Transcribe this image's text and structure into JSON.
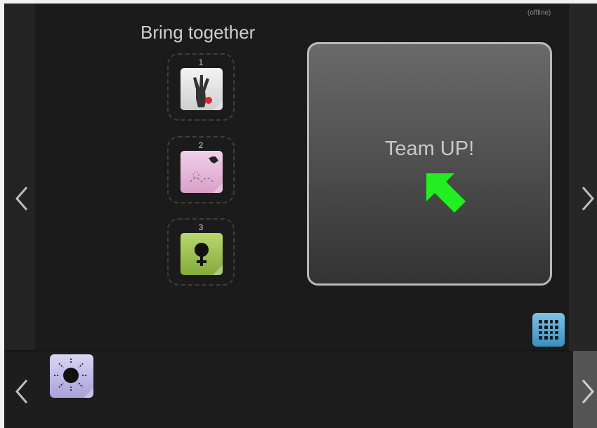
{
  "status": {
    "offline_label": "(offline)"
  },
  "title": "Bring together",
  "slots": [
    {
      "number": "1",
      "icon": "hand-gesture-icon",
      "color": "#d9d9d9"
    },
    {
      "number": "2",
      "icon": "animal-icon",
      "color": "#e3b6d8"
    },
    {
      "number": "3",
      "icon": "female-symbol-icon",
      "color": "#9fc552"
    }
  ],
  "teamup": {
    "label": "Team UP!",
    "arrow_color": "#22ee22",
    "arrow_icon": "arrow-up-left-icon"
  },
  "grid_button": {
    "icon": "grid-icon",
    "color": "#4ea7d8"
  },
  "shelf": {
    "items": [
      {
        "icon": "sun-icon",
        "color": "#bdb8ea"
      }
    ]
  },
  "navigation": {
    "left": "chevron-left-icon",
    "right": "chevron-right-icon"
  }
}
